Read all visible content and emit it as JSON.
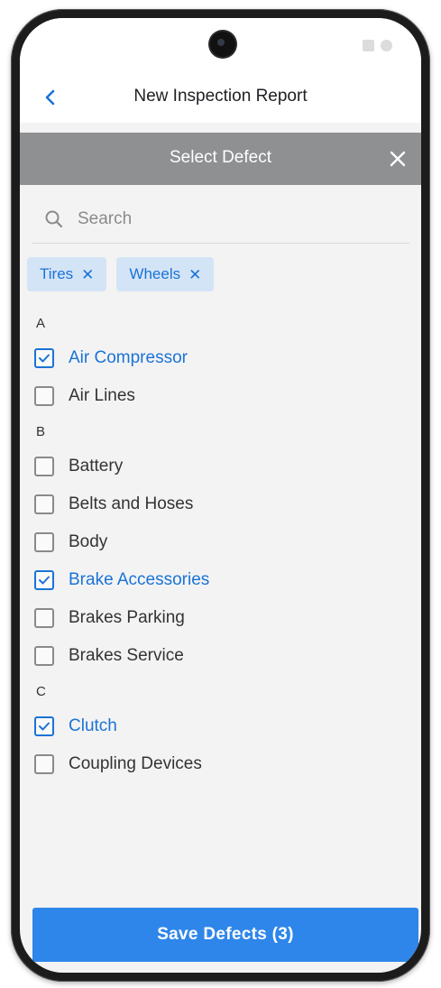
{
  "header": {
    "title": "New Inspection Report"
  },
  "modal": {
    "title": "Select Defect"
  },
  "search": {
    "placeholder": "Search"
  },
  "chips": [
    {
      "label": "Tires"
    },
    {
      "label": "Wheels"
    }
  ],
  "sections": [
    {
      "letter": "A",
      "items": [
        {
          "label": "Air Compressor",
          "checked": true
        },
        {
          "label": "Air Lines",
          "checked": false
        }
      ]
    },
    {
      "letter": "B",
      "items": [
        {
          "label": "Battery",
          "checked": false
        },
        {
          "label": "Belts and Hoses",
          "checked": false
        },
        {
          "label": "Body",
          "checked": false
        },
        {
          "label": "Brake Accessories",
          "checked": true
        },
        {
          "label": "Brakes Parking",
          "checked": false
        },
        {
          "label": "Brakes Service",
          "checked": false
        }
      ]
    },
    {
      "letter": "C",
      "items": [
        {
          "label": "Clutch",
          "checked": true
        },
        {
          "label": "Coupling Devices",
          "checked": false
        }
      ]
    }
  ],
  "footer": {
    "save_label": "Save Defects (3)"
  },
  "colors": {
    "accent": "#2e86ea",
    "checked_text": "#1a73d6",
    "modal_header": "#8e9092",
    "chip_bg": "#d4e4f7"
  },
  "icons": {
    "back": "chevron-left-icon",
    "close": "close-icon",
    "search": "search-icon",
    "chip_remove": "close-icon",
    "checkbox_checked": "check-icon"
  }
}
